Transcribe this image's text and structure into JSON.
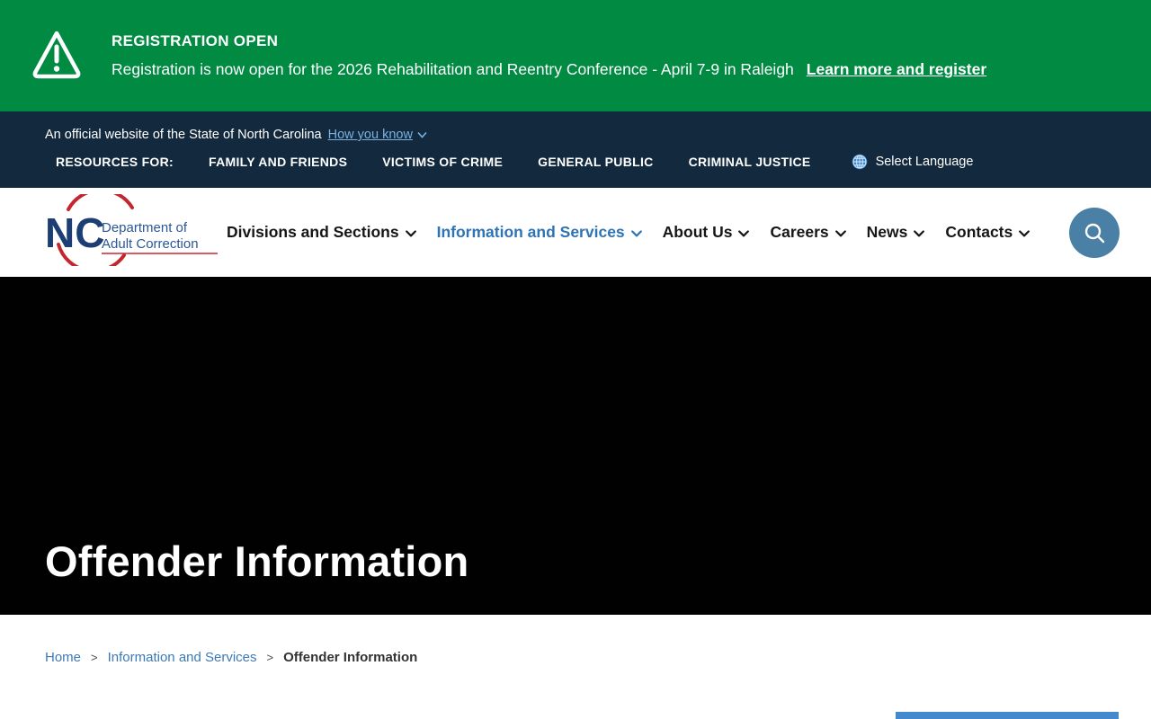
{
  "alert": {
    "title": "REGISTRATION OPEN",
    "message": "Registration is now open for the 2026 Rehabilitation and Reentry Conference - April 7-9 in Raleigh",
    "link_label": "Learn more and register"
  },
  "utility": {
    "official_text": "An official website of the State of North Carolina",
    "how_link": "How you know",
    "resources_label": "RESOURCES FOR:",
    "links": [
      "FAMILY AND FRIENDS",
      "VICTIMS OF CRIME",
      "GENERAL PUBLIC",
      "CRIMINAL JUSTICE"
    ],
    "language": "Select Language"
  },
  "header": {
    "logo": {
      "nc": "NC",
      "line1": "Department of",
      "line2": "Adult Correction"
    },
    "nav": [
      {
        "label": "Divisions and Sections",
        "active": false
      },
      {
        "label": "Information and Services",
        "active": true
      },
      {
        "label": "About Us",
        "active": false
      },
      {
        "label": "Careers",
        "active": false
      },
      {
        "label": "News",
        "active": false
      },
      {
        "label": "Contacts",
        "active": false
      }
    ]
  },
  "hero": {
    "title": "Offender Information"
  },
  "breadcrumb": {
    "separator": ">",
    "items": [
      {
        "label": "Home",
        "link": true
      },
      {
        "label": "Information and Services",
        "link": true
      },
      {
        "label": "Offender Information",
        "link": false
      }
    ]
  },
  "colors": {
    "alert_green": "#008a42",
    "utility_navy": "#13293e",
    "nav_active_blue": "#2e73b5",
    "utility_link_blue": "#79b2e0",
    "search_button_blue": "#4a80a6",
    "logo_navy": "#1d3e74",
    "logo_red": "#c5262e",
    "breadcrumb_link_blue": "#3d7ab5",
    "card_accent_blue": "#4489ce",
    "hero_black": "#010101"
  }
}
